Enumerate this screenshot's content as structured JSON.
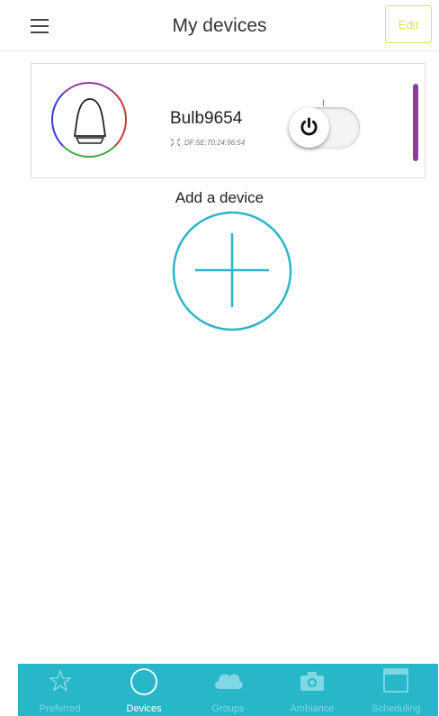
{
  "header": {
    "title": "My devices",
    "edit_label": "Edit"
  },
  "device": {
    "name": "Bulb9654",
    "mac": "DF:5E:70:24:96:54",
    "power_state": "off",
    "ring_colors": [
      "#8f3f9a",
      "#c43c3c",
      "#3da83d",
      "#3a3ccf"
    ],
    "status_color": "#8a3fa0",
    "icons": [
      "bulb-icon",
      "link-icon",
      "power-icon"
    ]
  },
  "add_device": {
    "label": "Add a device",
    "icon": "plus-icon",
    "color": "#27b7c8"
  },
  "nav": {
    "background": "#27b7c8",
    "active": "Devices",
    "items": [
      {
        "label": "Preferred",
        "icon": "star-icon"
      },
      {
        "label": "Devices",
        "icon": "circle-icon"
      },
      {
        "label": "Groups",
        "icon": "cloud-icon"
      },
      {
        "label": "Ambiance",
        "icon": "camera-icon"
      },
      {
        "label": "Scheduling",
        "icon": "calendar-icon"
      }
    ]
  },
  "accent_edit": "#e6dd4a"
}
